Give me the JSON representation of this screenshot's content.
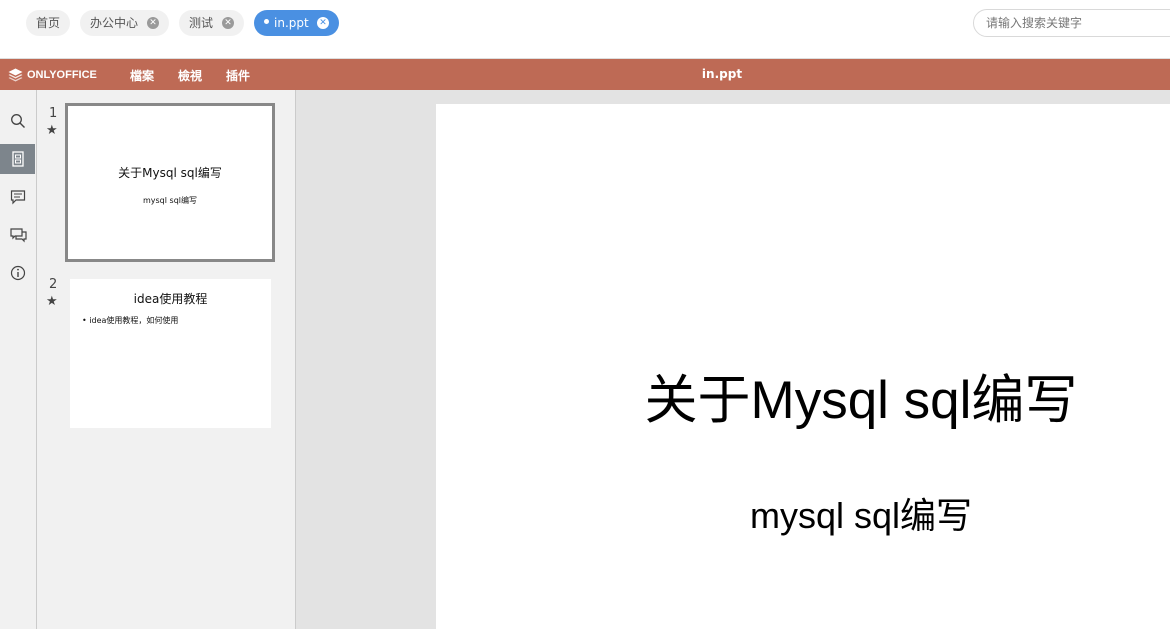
{
  "top_tabs": [
    {
      "label": "首页",
      "closable": false,
      "active": false
    },
    {
      "label": "办公中心",
      "closable": true,
      "active": false
    },
    {
      "label": "测试",
      "closable": true,
      "active": false
    },
    {
      "label": "in.ppt",
      "closable": true,
      "active": true
    }
  ],
  "search": {
    "placeholder": "请输入搜索关键字"
  },
  "editor": {
    "brand": "ONLYOFFICE",
    "menu": [
      "檔案",
      "檢視",
      "插件"
    ],
    "doc_title": "in.ppt"
  },
  "left_rail": [
    "search-icon",
    "slides-icon",
    "comment-icon",
    "chat-icon",
    "info-icon"
  ],
  "thumbnails": [
    {
      "number": "1",
      "star": "★",
      "title": "关于Mysql sql编写",
      "subtitle": "mysql sql编写"
    },
    {
      "number": "2",
      "star": "★",
      "title": "idea使用教程",
      "bullet": "• idea使用教程，如何使用"
    }
  ],
  "slide": {
    "title": "关于Mysql sql编写",
    "subtitle": "mysql sql编写"
  },
  "colors": {
    "header": "#be6a55",
    "active_tab": "#4a90e2"
  }
}
